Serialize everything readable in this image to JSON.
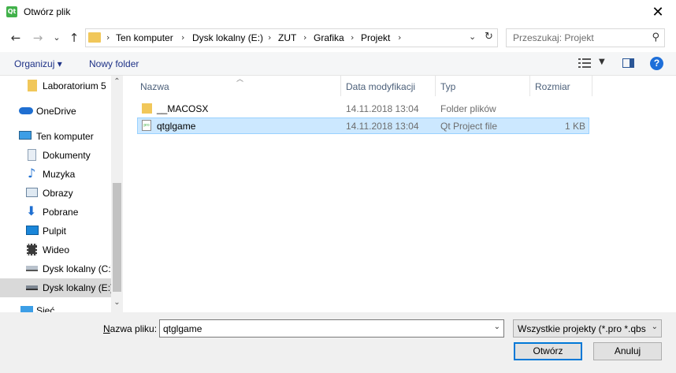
{
  "window": {
    "title": "Otwórz plik",
    "app_icon_text": "Qt",
    "close_glyph": "✕"
  },
  "nav": {
    "back": "←",
    "forward": "→",
    "recent": "⌄",
    "up": "↑"
  },
  "breadcrumb": [
    "Ten komputer",
    "Dysk lokalny (E:)",
    "ZUT",
    "Grafika",
    "Projekt"
  ],
  "search": {
    "placeholder": "Przeszukaj: Projekt"
  },
  "toolbar": {
    "organize": "Organizuj ▾",
    "new_folder": "Nowy folder",
    "help": "?"
  },
  "sidebar": {
    "items": [
      {
        "label": "Laboratorium 5",
        "icon": "folder-icon"
      },
      {
        "label": "OneDrive",
        "icon": "cloud-icon"
      },
      {
        "label": "Ten komputer",
        "icon": "computer-icon"
      },
      {
        "label": "Dokumenty",
        "icon": "documents-icon"
      },
      {
        "label": "Muzyka",
        "icon": "music-icon"
      },
      {
        "label": "Obrazy",
        "icon": "pictures-icon"
      },
      {
        "label": "Pobrane",
        "icon": "download-icon"
      },
      {
        "label": "Pulpit",
        "icon": "desktop-icon"
      },
      {
        "label": "Wideo",
        "icon": "video-icon"
      },
      {
        "label": "Dysk lokalny (C:)",
        "icon": "drive-icon"
      },
      {
        "label": "Dysk lokalny (E:)",
        "icon": "drive-icon"
      },
      {
        "label": "Sieć",
        "icon": "network-icon"
      }
    ]
  },
  "columns": {
    "name": "Nazwa",
    "modified": "Data modyfikacji",
    "type": "Typ",
    "size": "Rozmiar"
  },
  "files": [
    {
      "name": "__MACOSX",
      "modified": "14.11.2018 13:04",
      "type": "Folder plików",
      "size": ""
    },
    {
      "name": "qtglgame",
      "modified": "14.11.2018 13:04",
      "type": "Qt Project file",
      "size": "1 KB"
    }
  ],
  "bottom": {
    "filename_label_u": "N",
    "filename_label_rest": "azwa pliku:",
    "filename_value": "qtglgame",
    "filter": "Wszystkie projekty (*.pro *.qbs",
    "open": "Otwórz",
    "cancel": "Anuluj"
  },
  "colors": {
    "accent": "#0078d7",
    "selection": "#cce8ff",
    "link": "#1e3287"
  }
}
